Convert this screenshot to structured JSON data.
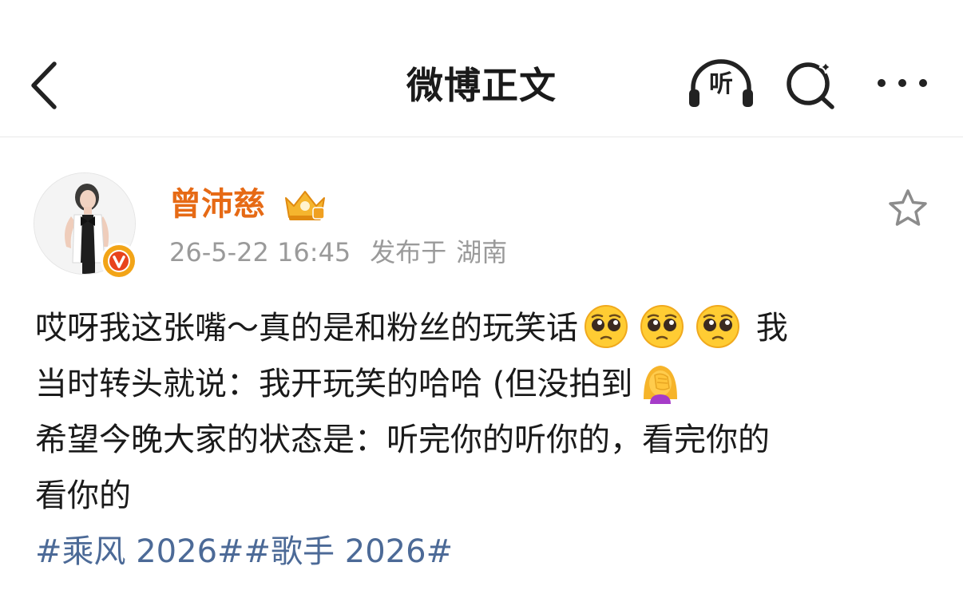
{
  "header": {
    "title": "微博正文",
    "listen_label": "听"
  },
  "post": {
    "author": {
      "name": "曾沛慈",
      "avatar_icon": "avatar-photo",
      "verified_badge_icon": "verified-v-icon",
      "member_badge_icon": "crown-icon"
    },
    "timestamp": "26-5-22 16:45",
    "location_prefix": "发布于",
    "location": "湖南",
    "content": {
      "line1_text": "哎呀我这张嘴～真的是和粉丝的玩笑话",
      "line1_tail": "我",
      "line2_text": "当时转头就说：我开玩笑的哈哈 (但没拍到",
      "line3_text": "希望今晚大家的状态是：听完你的听你的，看完你的",
      "line4_text": "看你的",
      "topic1": "#乘风 2026#",
      "topic2": "#歌手 2026#",
      "emojis": [
        "pleading-face-icon",
        "pleading-face-icon",
        "pleading-face-icon",
        "facepalm-icon"
      ]
    }
  },
  "colors": {
    "author_name": "#e66a15",
    "meta": "#9a9a9a",
    "topic": "#4c6a97",
    "verified_badge": "#f2a417"
  }
}
